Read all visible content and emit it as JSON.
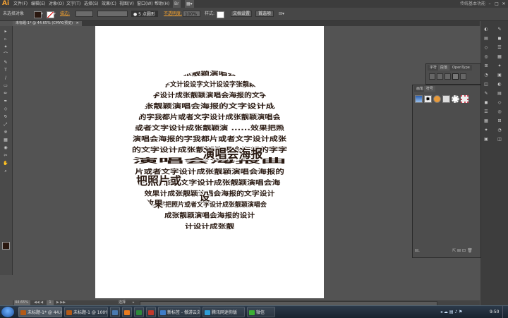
{
  "app": {
    "logo": "Ai",
    "workspace": "传统基本功能"
  },
  "menu": [
    "文件(F)",
    "编辑(E)",
    "对象(O)",
    "文字(T)",
    "选择(S)",
    "效果(C)",
    "视图(V)",
    "窗口(W)",
    "帮助(H)"
  ],
  "window_buttons": [
    "–",
    "□",
    "✕"
  ],
  "control_bar": {
    "selection_label": "未选择对象",
    "stroke_label": "描边:",
    "stroke_profile": "● 5 点圆形",
    "opacity_label": "不透明度:",
    "opacity_value": "100%",
    "style_label": "样式:",
    "doc_setup": "文档设置",
    "preferences": "首选项"
  },
  "doc_tab": {
    "label": "未标题-1* @ 44.65% (CMYK/预览)",
    "close": "✕"
  },
  "tools": [
    "▸",
    "▹",
    "✦",
    "⌒",
    "✎",
    "T",
    "/",
    "▭",
    "✏",
    "✒",
    "◇",
    "↻",
    "⤢",
    "✵",
    "▦",
    "◉",
    "✂",
    "✋",
    "⌕"
  ],
  "panels": {
    "character_tabs": [
      "字符",
      "段落",
      "OpenType"
    ],
    "symbol_tabs": [
      "画笔",
      "符号"
    ]
  },
  "artwork": {
    "lines": [
      "张靓颖演唱会",
      "字文计设设字文计设设字张靓颖",
      "字设计成张靓颖演唱会海报的文字",
      "张靓颖演唱会海报的文字设计成",
      "的字我都片或者文字设计成张靓颖演唱会",
      "或者文字设计成张靓颖演 ......效果把照",
      "演唱会海报的字我都片或者文字设计成张",
      "的文字设计成张靓颖演唱会海报的字字",
      "演唱会海报曲",
      "片或者文字设计成张靓颖演唱会海报的",
      "把照片或者文字设计成张靓颖演唱会海",
      "效果计成张靓颖演唱会海报的文字设计",
      "的字把照片或者文字设计成张靓颖演唱会",
      "成张靓颖演唱会海报的设计",
      "计设计成张靓"
    ],
    "big": [
      "演唱会海报",
      "把照片或",
      "设",
      "效果"
    ]
  },
  "status": {
    "zoom": "44.65%",
    "page": "1",
    "tool_label": "选择"
  },
  "taskbar": {
    "items": [
      {
        "label": "未标题-1* @ 44.6...",
        "color": "#b35a17"
      },
      {
        "label": "未标题-1 @ 100%(...",
        "color": "#b35a17"
      },
      {
        "label": "",
        "color": "#4a7ab0"
      },
      {
        "label": "",
        "color": "#e87b1f"
      },
      {
        "label": "",
        "color": "#2d8a3a"
      },
      {
        "label": "",
        "color": "#c0392b"
      },
      {
        "label": "新标签 - 傲游云浏览...",
        "color": "#3e7cc8"
      },
      {
        "label": "腾讯网迷你版",
        "color": "#2e9dd6"
      },
      {
        "label": "微信",
        "color": "#3cb034"
      }
    ],
    "time": "9:50"
  }
}
